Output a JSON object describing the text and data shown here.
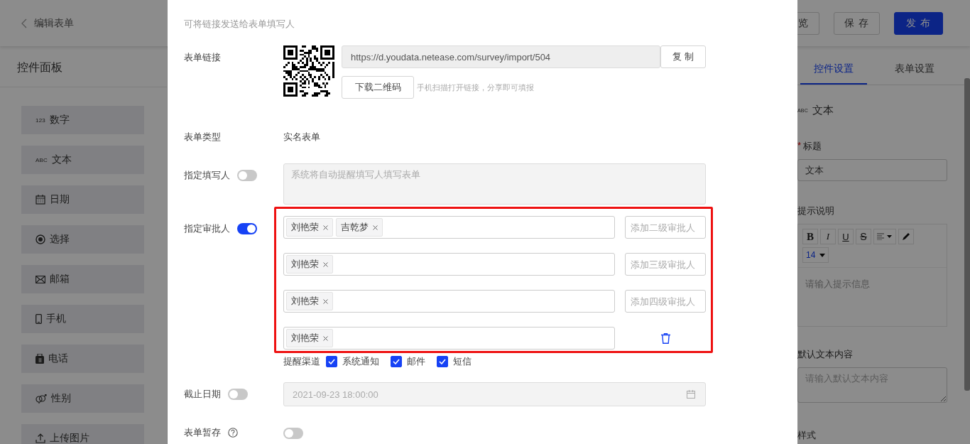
{
  "header": {
    "back_label": "编辑表单",
    "buttons": [
      {
        "label": "览",
        "kind": "outline"
      },
      {
        "label": "保 存",
        "kind": "outline"
      },
      {
        "label": "发 布",
        "kind": "primary"
      }
    ]
  },
  "control_panel": {
    "title": "控件面板",
    "items": [
      {
        "label": "数字",
        "kind": "glyph",
        "glyph": "123"
      },
      {
        "label": "文本",
        "kind": "glyph",
        "glyph": "ABC"
      },
      {
        "label": "日期",
        "kind": "calendar"
      },
      {
        "label": "选择",
        "kind": "radio"
      },
      {
        "label": "邮箱",
        "kind": "mail"
      },
      {
        "label": "手机",
        "kind": "mobile"
      },
      {
        "label": "电话",
        "kind": "phone"
      },
      {
        "label": "性别",
        "kind": "gender"
      },
      {
        "label": "上传图片",
        "kind": "upload"
      }
    ]
  },
  "settings_panel": {
    "tabs": [
      {
        "label": "控件设置",
        "selected": true
      },
      {
        "label": "表单设置",
        "selected": false
      }
    ],
    "control": {
      "glyph": "ABC",
      "name": "文本"
    },
    "title_field": {
      "label": "标题",
      "required": true,
      "required_mark": "*",
      "value": "文本"
    },
    "hint_field": {
      "label": "提示说明",
      "toolbar": [
        {
          "kind": "bold",
          "label": "B"
        },
        {
          "kind": "italic",
          "label": "I"
        },
        {
          "kind": "underline",
          "label": "U"
        },
        {
          "kind": "strike",
          "label": "S"
        },
        {
          "kind": "align"
        },
        {
          "kind": "color"
        }
      ],
      "font_size": "14",
      "placeholder": "请输入提示信息"
    },
    "default_field": {
      "label": "默认文本内容",
      "placeholder": "请输入默认文本内容"
    },
    "style_label": "样式"
  },
  "modal": {
    "intro": "可将链接发送给表单填写人",
    "link": {
      "label": "表单链接",
      "url": "https://d.youdata.netease.com/survey/import/504",
      "copy_label": "复 制",
      "download_label": "下载二维码",
      "hint": "手机扫描打开链接，分享即可填报"
    },
    "type": {
      "label": "表单类型",
      "value": "实名表单"
    },
    "filler": {
      "label": "指定填写人",
      "on": false,
      "placeholder": "系统将自动提醒填写人填写表单"
    },
    "approvers": {
      "label": "指定审批人",
      "on": true,
      "highlighted": true,
      "levels": [
        {
          "tags": [
            "刘艳荣",
            "吉乾梦"
          ],
          "kind": "add",
          "placeholder": "添加二级审批人"
        },
        {
          "tags": [
            "刘艳荣"
          ],
          "kind": "add",
          "placeholder": "添加三级审批人"
        },
        {
          "tags": [
            "刘艳荣"
          ],
          "kind": "add",
          "placeholder": "添加四级审批人"
        },
        {
          "tags": [
            "刘艳荣"
          ],
          "kind": "delete"
        }
      ]
    },
    "channels": {
      "label": "提醒渠道",
      "options": [
        {
          "label": "系统通知",
          "checked": true
        },
        {
          "label": "邮件",
          "checked": true
        },
        {
          "label": "短信",
          "checked": true
        }
      ]
    },
    "deadline": {
      "label": "截止日期",
      "on": false,
      "value": "2021-09-23 18:00:00"
    },
    "draft": {
      "label": "表单暂存",
      "on": false
    }
  }
}
